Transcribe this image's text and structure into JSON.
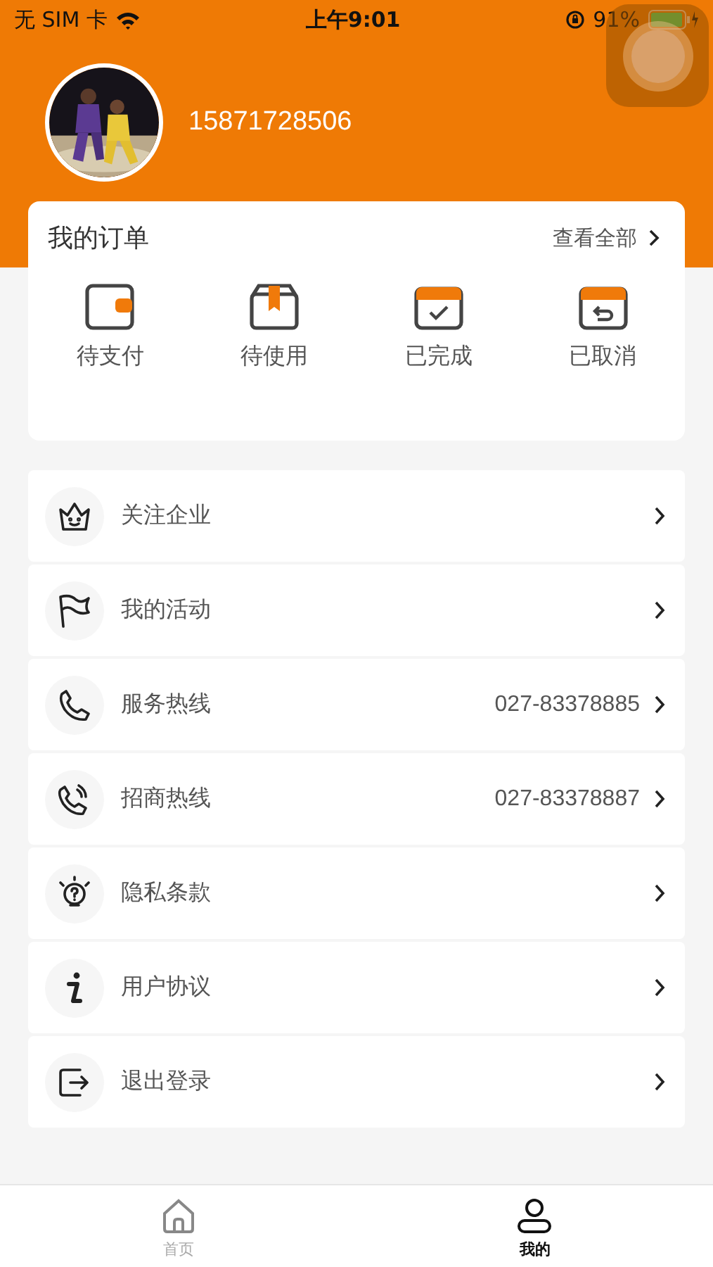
{
  "status_bar": {
    "carrier": "无 SIM 卡",
    "time": "上午9:01",
    "battery": "91%"
  },
  "profile": {
    "phone": "15871728506"
  },
  "orders": {
    "title": "我的订单",
    "view_all": "查看全部",
    "items": [
      {
        "label": "待支付"
      },
      {
        "label": "待使用"
      },
      {
        "label": "已完成"
      },
      {
        "label": "已取消"
      }
    ]
  },
  "menu": [
    {
      "label": "关注企业"
    },
    {
      "label": "我的活动"
    },
    {
      "label": "服务热线",
      "value": "027-83378885"
    },
    {
      "label": "招商热线",
      "value": "027-83378887"
    },
    {
      "label": "隐私条款"
    },
    {
      "label": "用户协议"
    },
    {
      "label": "退出登录"
    }
  ],
  "tab_bar": [
    {
      "label": "首页",
      "selected": false
    },
    {
      "label": "我的",
      "selected": true
    }
  ]
}
